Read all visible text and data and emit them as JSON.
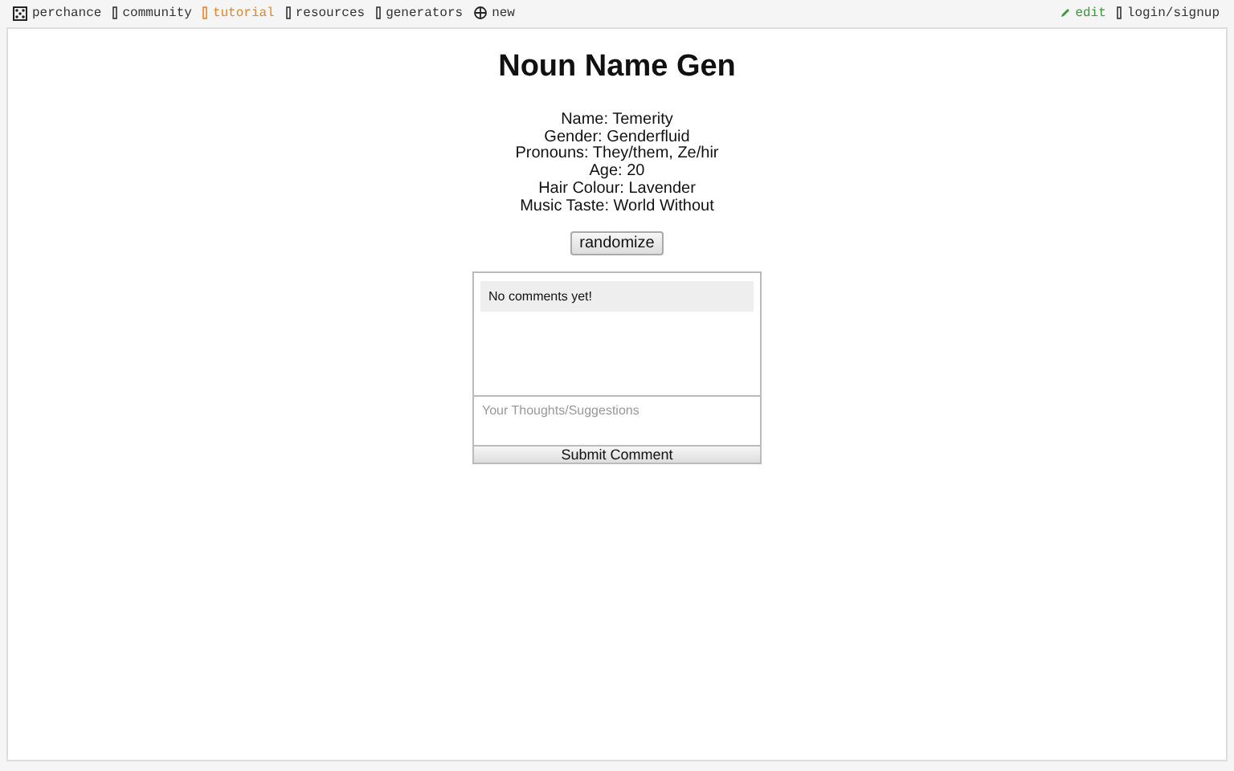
{
  "nav_left": [
    {
      "label": "perchance",
      "kind": "dice",
      "color": "#333333"
    },
    {
      "label": "community",
      "kind": "box",
      "color": "#333333"
    },
    {
      "label": "tutorial",
      "kind": "box",
      "color": "#e8852a"
    },
    {
      "label": "resources",
      "kind": "box",
      "color": "#333333"
    },
    {
      "label": "generators",
      "kind": "box",
      "color": "#333333"
    },
    {
      "label": "new",
      "kind": "globe",
      "color": "#333333"
    }
  ],
  "nav_right": [
    {
      "label": "edit",
      "kind": "pencil",
      "color": "#3a9a3a"
    },
    {
      "label": "login/signup",
      "kind": "box",
      "color": "#333333"
    }
  ],
  "title": "Noun Name Gen",
  "details": [
    "Name: Temerity",
    "Gender: Genderfluid",
    "Pronouns: They/them, Ze/hir",
    "Age: 20",
    "Hair Colour: Lavender",
    "Music Taste: World Without"
  ],
  "randomize_button": "randomize",
  "comments": {
    "messages": [
      "No comments yet!"
    ],
    "placeholder": "Your Thoughts/Suggestions",
    "submit_button": "Submit Comment"
  }
}
